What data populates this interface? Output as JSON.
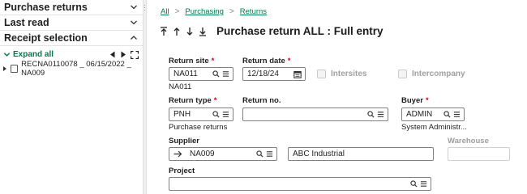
{
  "sidebar": {
    "sections": [
      {
        "label": "Purchase returns"
      },
      {
        "label": "Last read"
      },
      {
        "label": "Receipt selection"
      }
    ],
    "expand_all": "Expand all",
    "tree_item": "RECNA0110078 _ 06/15/2022 _ NA009"
  },
  "breadcrumb": [
    "All",
    "Purchasing",
    "Returns"
  ],
  "title": "Purchase return ALL : Full entry",
  "form": {
    "return_site": {
      "label": "Return site",
      "value": "NA011",
      "sub": "NA011"
    },
    "return_date": {
      "label": "Return date",
      "value": "12/18/24"
    },
    "intersites": {
      "label": "Intersites"
    },
    "intercompany": {
      "label": "Intercompany"
    },
    "return_type": {
      "label": "Return type",
      "value": "PNH",
      "sub": "Purchase returns"
    },
    "return_no": {
      "label": "Return no.",
      "value": ""
    },
    "buyer": {
      "label": "Buyer",
      "value": "ADMIN",
      "sub": "System Administr..."
    },
    "supplier": {
      "label": "Supplier",
      "value": "NA009",
      "name": "ABC Industrial"
    },
    "warehouse": {
      "label": "Warehouse",
      "value": ""
    },
    "project": {
      "label": "Project",
      "value": ""
    }
  },
  "colors": {
    "accent": "#00794d",
    "required": "#d1001a"
  }
}
